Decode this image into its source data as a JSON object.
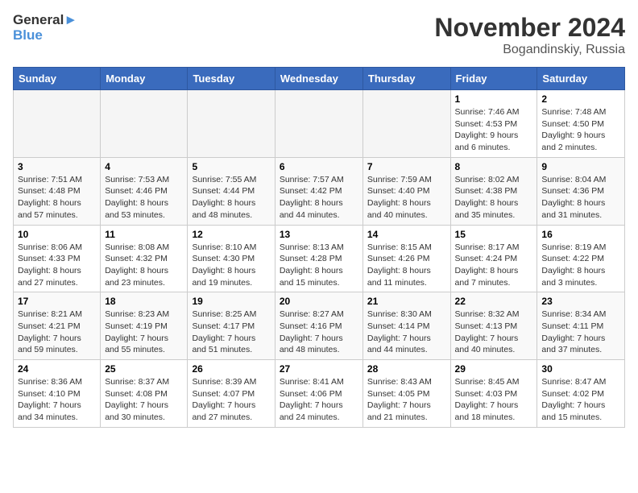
{
  "logo": {
    "line1": "General",
    "line2": "Blue"
  },
  "title": "November 2024",
  "location": "Bogandinskiy, Russia",
  "weekdays": [
    "Sunday",
    "Monday",
    "Tuesday",
    "Wednesday",
    "Thursday",
    "Friday",
    "Saturday"
  ],
  "weeks": [
    [
      {
        "day": "",
        "info": ""
      },
      {
        "day": "",
        "info": ""
      },
      {
        "day": "",
        "info": ""
      },
      {
        "day": "",
        "info": ""
      },
      {
        "day": "",
        "info": ""
      },
      {
        "day": "1",
        "info": "Sunrise: 7:46 AM\nSunset: 4:53 PM\nDaylight: 9 hours\nand 6 minutes."
      },
      {
        "day": "2",
        "info": "Sunrise: 7:48 AM\nSunset: 4:50 PM\nDaylight: 9 hours\nand 2 minutes."
      }
    ],
    [
      {
        "day": "3",
        "info": "Sunrise: 7:51 AM\nSunset: 4:48 PM\nDaylight: 8 hours\nand 57 minutes."
      },
      {
        "day": "4",
        "info": "Sunrise: 7:53 AM\nSunset: 4:46 PM\nDaylight: 8 hours\nand 53 minutes."
      },
      {
        "day": "5",
        "info": "Sunrise: 7:55 AM\nSunset: 4:44 PM\nDaylight: 8 hours\nand 48 minutes."
      },
      {
        "day": "6",
        "info": "Sunrise: 7:57 AM\nSunset: 4:42 PM\nDaylight: 8 hours\nand 44 minutes."
      },
      {
        "day": "7",
        "info": "Sunrise: 7:59 AM\nSunset: 4:40 PM\nDaylight: 8 hours\nand 40 minutes."
      },
      {
        "day": "8",
        "info": "Sunrise: 8:02 AM\nSunset: 4:38 PM\nDaylight: 8 hours\nand 35 minutes."
      },
      {
        "day": "9",
        "info": "Sunrise: 8:04 AM\nSunset: 4:36 PM\nDaylight: 8 hours\nand 31 minutes."
      }
    ],
    [
      {
        "day": "10",
        "info": "Sunrise: 8:06 AM\nSunset: 4:33 PM\nDaylight: 8 hours\nand 27 minutes."
      },
      {
        "day": "11",
        "info": "Sunrise: 8:08 AM\nSunset: 4:32 PM\nDaylight: 8 hours\nand 23 minutes."
      },
      {
        "day": "12",
        "info": "Sunrise: 8:10 AM\nSunset: 4:30 PM\nDaylight: 8 hours\nand 19 minutes."
      },
      {
        "day": "13",
        "info": "Sunrise: 8:13 AM\nSunset: 4:28 PM\nDaylight: 8 hours\nand 15 minutes."
      },
      {
        "day": "14",
        "info": "Sunrise: 8:15 AM\nSunset: 4:26 PM\nDaylight: 8 hours\nand 11 minutes."
      },
      {
        "day": "15",
        "info": "Sunrise: 8:17 AM\nSunset: 4:24 PM\nDaylight: 8 hours\nand 7 minutes."
      },
      {
        "day": "16",
        "info": "Sunrise: 8:19 AM\nSunset: 4:22 PM\nDaylight: 8 hours\nand 3 minutes."
      }
    ],
    [
      {
        "day": "17",
        "info": "Sunrise: 8:21 AM\nSunset: 4:21 PM\nDaylight: 7 hours\nand 59 minutes."
      },
      {
        "day": "18",
        "info": "Sunrise: 8:23 AM\nSunset: 4:19 PM\nDaylight: 7 hours\nand 55 minutes."
      },
      {
        "day": "19",
        "info": "Sunrise: 8:25 AM\nSunset: 4:17 PM\nDaylight: 7 hours\nand 51 minutes."
      },
      {
        "day": "20",
        "info": "Sunrise: 8:27 AM\nSunset: 4:16 PM\nDaylight: 7 hours\nand 48 minutes."
      },
      {
        "day": "21",
        "info": "Sunrise: 8:30 AM\nSunset: 4:14 PM\nDaylight: 7 hours\nand 44 minutes."
      },
      {
        "day": "22",
        "info": "Sunrise: 8:32 AM\nSunset: 4:13 PM\nDaylight: 7 hours\nand 40 minutes."
      },
      {
        "day": "23",
        "info": "Sunrise: 8:34 AM\nSunset: 4:11 PM\nDaylight: 7 hours\nand 37 minutes."
      }
    ],
    [
      {
        "day": "24",
        "info": "Sunrise: 8:36 AM\nSunset: 4:10 PM\nDaylight: 7 hours\nand 34 minutes."
      },
      {
        "day": "25",
        "info": "Sunrise: 8:37 AM\nSunset: 4:08 PM\nDaylight: 7 hours\nand 30 minutes."
      },
      {
        "day": "26",
        "info": "Sunrise: 8:39 AM\nSunset: 4:07 PM\nDaylight: 7 hours\nand 27 minutes."
      },
      {
        "day": "27",
        "info": "Sunrise: 8:41 AM\nSunset: 4:06 PM\nDaylight: 7 hours\nand 24 minutes."
      },
      {
        "day": "28",
        "info": "Sunrise: 8:43 AM\nSunset: 4:05 PM\nDaylight: 7 hours\nand 21 minutes."
      },
      {
        "day": "29",
        "info": "Sunrise: 8:45 AM\nSunset: 4:03 PM\nDaylight: 7 hours\nand 18 minutes."
      },
      {
        "day": "30",
        "info": "Sunrise: 8:47 AM\nSunset: 4:02 PM\nDaylight: 7 hours\nand 15 minutes."
      }
    ]
  ]
}
